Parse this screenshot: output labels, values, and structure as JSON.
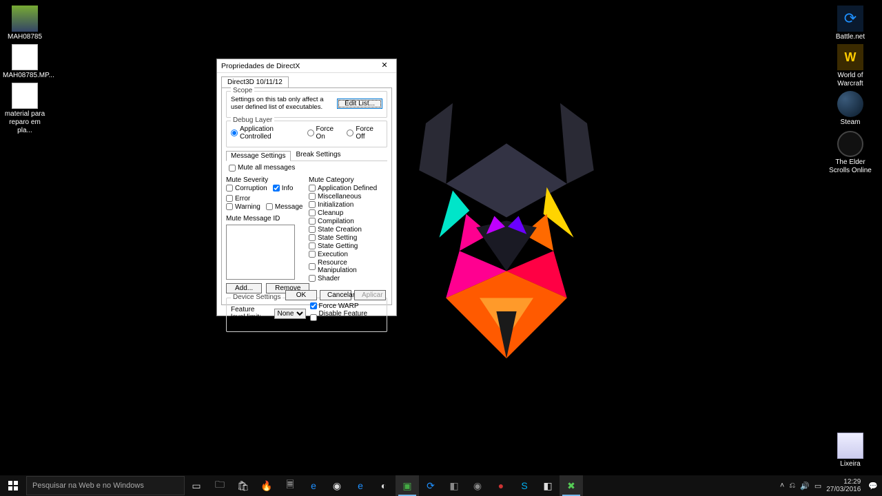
{
  "desktop": {
    "icons_left": [
      {
        "label": "MAH08785"
      },
      {
        "label": "MAH08785.MP..."
      },
      {
        "label": "material para reparo em pla..."
      }
    ],
    "icons_right": [
      {
        "label": "Battle.net"
      },
      {
        "label": "World of Warcraft"
      },
      {
        "label": "Steam"
      },
      {
        "label": "The Elder Scrolls Online"
      }
    ],
    "recycle": "Lixeira"
  },
  "dialog": {
    "title": "Propriedades de DirectX",
    "tab": "Direct3D 10/11/12",
    "scope": {
      "title": "Scope",
      "text": "Settings on this tab only affect a user defined list of executables.",
      "edit_btn": "Edit List..."
    },
    "debug": {
      "title": "Debug Layer",
      "opt1": "Application Controlled",
      "opt2": "Force On",
      "opt3": "Force Off"
    },
    "subtabs": {
      "msg": "Message Settings",
      "brk": "Break Settings"
    },
    "mute_all": "Mute all messages",
    "severity": {
      "title": "Mute Severity",
      "corruption": "Corruption",
      "info": "Info",
      "error": "Error",
      "warning": "Warning",
      "message": "Message"
    },
    "mute_msg_id": "Mute Message ID",
    "add_btn": "Add...",
    "remove_btn": "Remove",
    "category": {
      "title": "Mute Category",
      "items": [
        "Application Defined",
        "Miscellaneous",
        "Initialization",
        "Cleanup",
        "Compilation",
        "State Creation",
        "State Setting",
        "State Getting",
        "Execution",
        "Resource Manipulation",
        "Shader"
      ]
    },
    "device": {
      "title": "Device Settings",
      "level": "Feature level limit:",
      "none": "None",
      "warp": "Force WARP",
      "disable": "Disable Feature Level Upgrade"
    },
    "buttons": {
      "ok": "OK",
      "cancel": "Cancelar",
      "apply": "Aplicar"
    }
  },
  "taskbar": {
    "search": "Pesquisar na Web e no Windows",
    "time": "12:29",
    "date": "27/03/2016"
  }
}
